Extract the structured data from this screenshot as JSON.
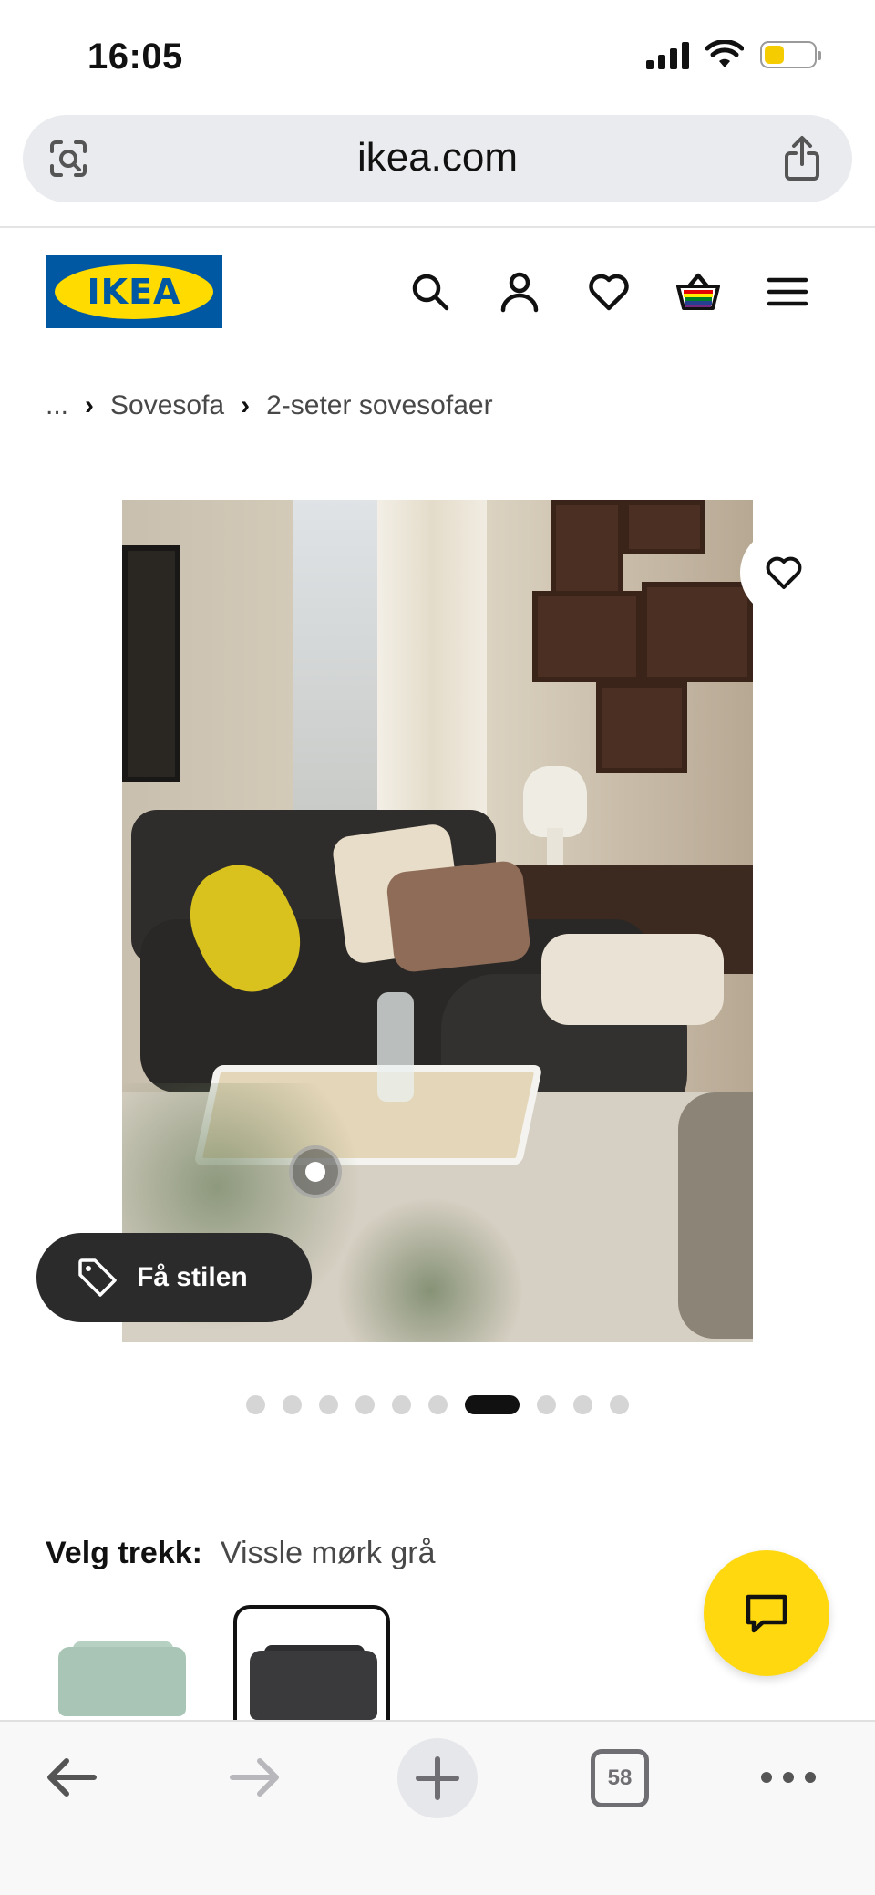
{
  "status_bar": {
    "time": "16:05"
  },
  "browser": {
    "url": "ikea.com",
    "tab_count": "58"
  },
  "header": {
    "logo_text": "IKEA"
  },
  "breadcrumb": {
    "ellipsis": "...",
    "separator": "›",
    "items": [
      "Sovesofa",
      "2-seter sovesofaer"
    ]
  },
  "gallery": {
    "style_button_label": "Få stilen",
    "total_images": 10,
    "active_index": 7
  },
  "fabric": {
    "label": "Velg trekk:",
    "value": "Vissle mørk grå",
    "swatches": [
      {
        "color": "#a9c5b5"
      },
      {
        "color": "#3a3a3c"
      }
    ]
  },
  "colors": {
    "ikea_blue": "#0058a3",
    "ikea_yellow": "#ffdb00",
    "chat_yellow": "#ffd80f"
  }
}
